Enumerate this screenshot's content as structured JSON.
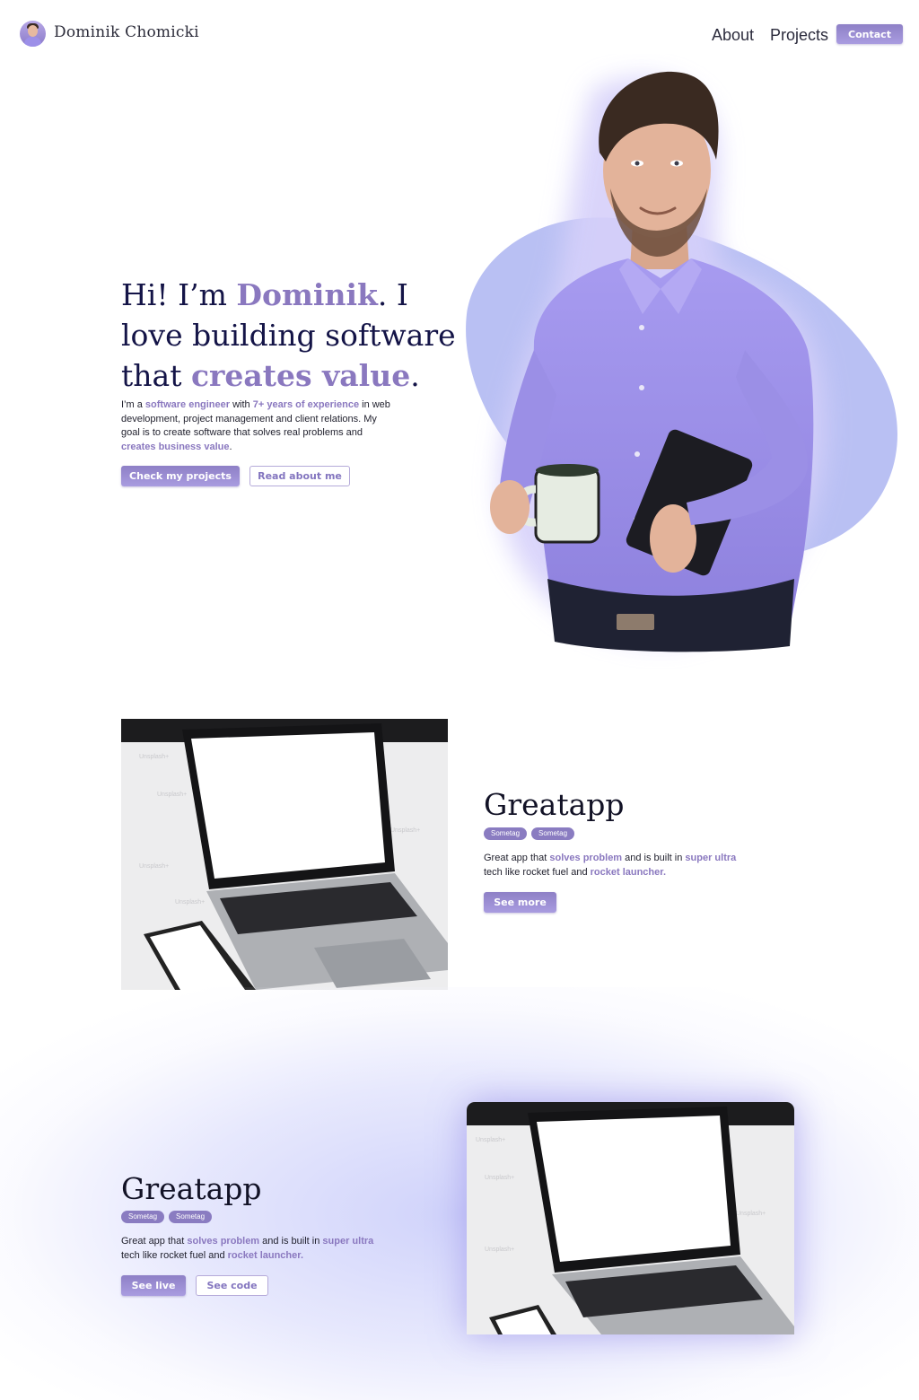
{
  "nav": {
    "name": "Dominik Chomicki",
    "links": [
      "About",
      "Projects"
    ],
    "contact_label": "Contact"
  },
  "hero": {
    "title": {
      "p1": "Hi! I’m ",
      "name": "Dominik",
      "p2": ". I love building software that ",
      "accent": "creates value",
      "p3": "."
    },
    "text": {
      "t1": "I’m a ",
      "h1": "software engineer",
      "t2": " with ",
      "h2": "7+ years of experience",
      "t3": " in web development, project management and client relations. My goal is to create software that solves real problems and ",
      "h3": "creates business value",
      "t4": "."
    },
    "primary_button": "Check my projects",
    "secondary_button": "Read about me"
  },
  "projects": [
    {
      "title": "Greatapp",
      "tags": [
        "Sometag",
        "Sometag"
      ],
      "desc": {
        "t1": "Great app that ",
        "h1": "solves problem",
        "t2": " and is built in ",
        "h2": "super ultra",
        "t3": " tech like rocket fuel and ",
        "h3": "rocket launcher."
      },
      "button": "See more"
    },
    {
      "title": "Greatapp",
      "tags": [
        "Sometag",
        "Sometag"
      ],
      "desc": {
        "t1": "Great app that ",
        "h1": "solves problem",
        "t2": " and is built in ",
        "h2": "super ultra",
        "t3": " tech like rocket fuel and ",
        "h3": "rocket launcher."
      },
      "buttons": [
        "See live",
        "See code"
      ]
    }
  ],
  "watermark": "Unsplash+",
  "colors": {
    "accent": "#8a78bf",
    "heading": "#141447",
    "blob": "#b9c0f3"
  }
}
